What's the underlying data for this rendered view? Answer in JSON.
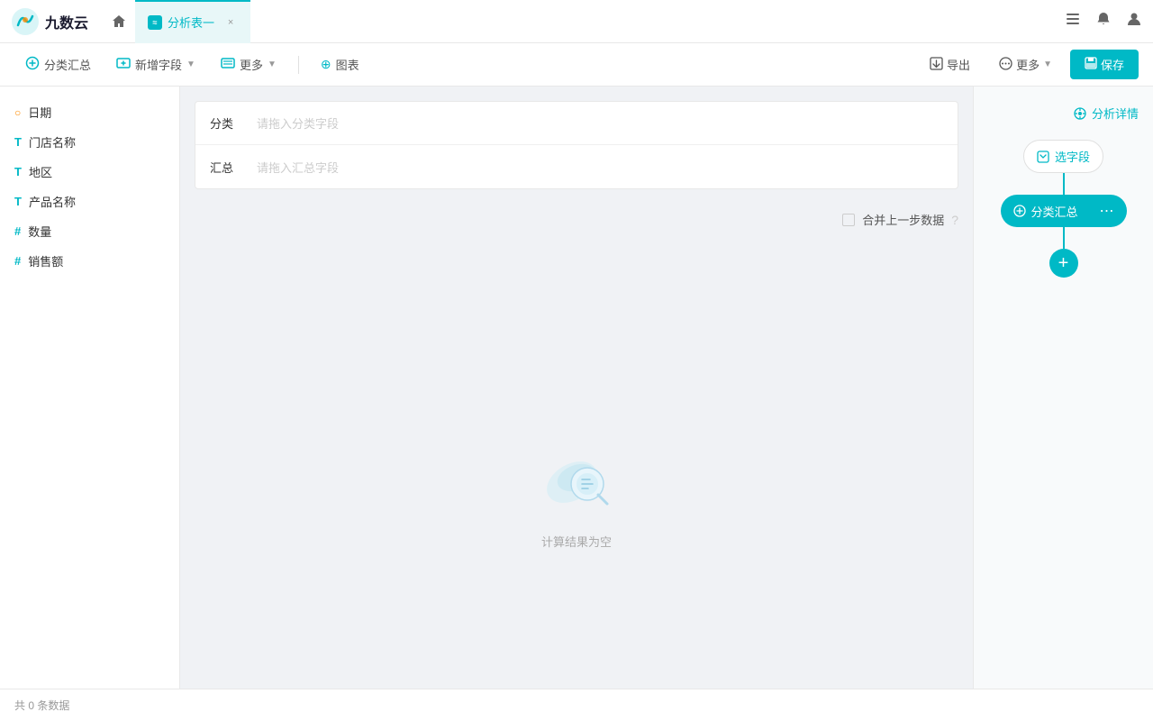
{
  "app": {
    "logo_text": "九数云",
    "home_icon": "🏠"
  },
  "nav": {
    "tab_label": "分析表一",
    "tab_close": "×"
  },
  "nav_actions": {
    "list_icon": "≡",
    "bell_icon": "🔔",
    "user_icon": "👤"
  },
  "toolbar": {
    "classify_summary_label": "分类汇总",
    "add_field_label": "新增字段",
    "more_label": "更多",
    "chart_label": "图表",
    "export_label": "导出",
    "more_right_label": "更多",
    "save_label": "保存"
  },
  "sidebar": {
    "fields": [
      {
        "type": "date",
        "type_label": "○",
        "name": "日期"
      },
      {
        "type": "text",
        "type_label": "T",
        "name": "门店名称"
      },
      {
        "type": "text",
        "type_label": "T",
        "name": "地区"
      },
      {
        "type": "text",
        "type_label": "T",
        "name": "产品名称"
      },
      {
        "type": "number",
        "type_label": "#",
        "name": "数量"
      },
      {
        "type": "number",
        "type_label": "#",
        "name": "销售额"
      }
    ]
  },
  "dropzones": {
    "category_label": "分类",
    "category_placeholder": "请拖入分类字段",
    "summary_label": "汇总",
    "summary_placeholder": "请拖入汇总字段"
  },
  "merge": {
    "label": "合并上一步数据"
  },
  "empty_state": {
    "text": "计算结果为空"
  },
  "right_panel": {
    "analysis_detail_label": "分析详情",
    "select_field_label": "选字段",
    "classify_summary_label": "分类汇总",
    "more_icon": "⋯",
    "add_icon": "+"
  },
  "footer": {
    "count_text": "共 0 条数据"
  }
}
